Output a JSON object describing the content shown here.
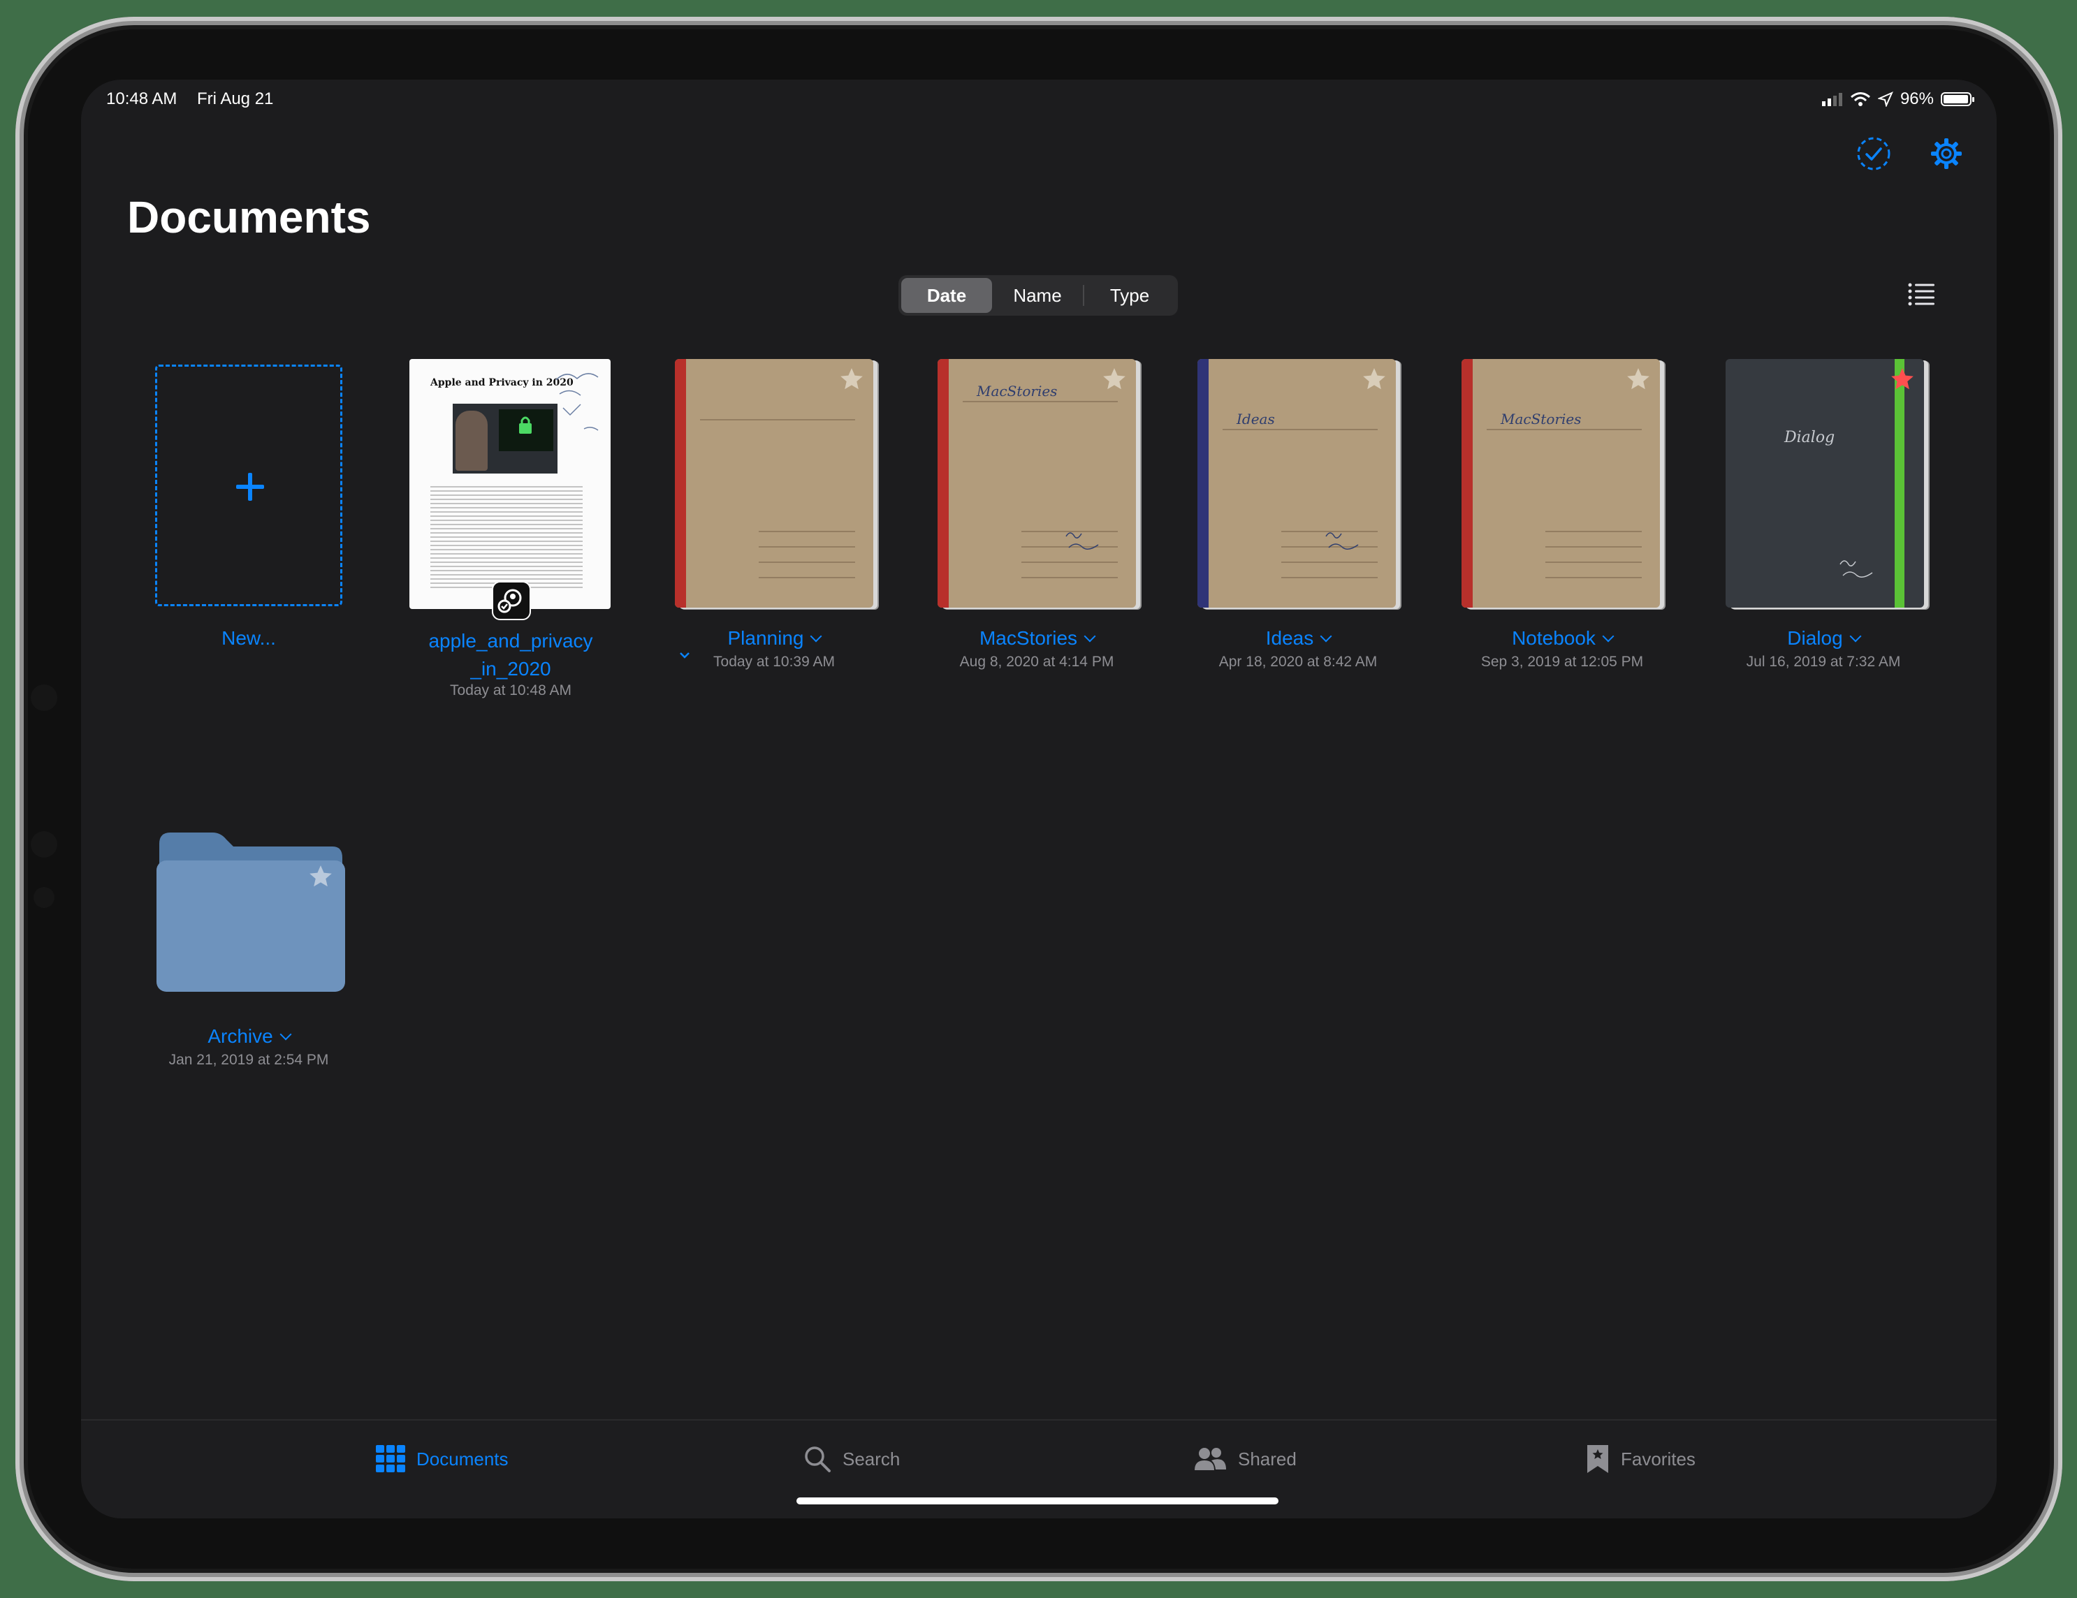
{
  "status_bar": {
    "time": "10:48 AM",
    "date": "Fri Aug 21",
    "battery": "96%",
    "battery_level": 0.96
  },
  "header": {
    "title": "Documents",
    "select_icon": "checkmark-circle-icon",
    "settings_icon": "gear-icon"
  },
  "sort": {
    "options": [
      "Date",
      "Name",
      "Type"
    ],
    "selected": "Date"
  },
  "view_toggle_icon": "list-icon",
  "new_item": {
    "label": "New..."
  },
  "documents": [
    {
      "name_line1": "apple_and_privacy",
      "name_line2": "_in_2020",
      "date": "Today at 10:48 AM"
    },
    {
      "name": "Planning",
      "date": "Today at 10:39 AM",
      "spine_color": "#b8302b"
    },
    {
      "name": "MacStories",
      "date": "Aug 8, 2020 at 4:14 PM",
      "spine_color": "#b8302b",
      "cover_text": "MacStories"
    },
    {
      "name": "Ideas",
      "date": "Apr 18, 2020 at 8:42 AM",
      "spine_color": "#2f3477",
      "cover_text": "Ideas"
    },
    {
      "name": "Notebook",
      "date": "Sep 3, 2019 at 12:05 PM",
      "spine_color": "#b8302b",
      "cover_text": "MacStories"
    },
    {
      "name": "Dialog",
      "date": "Jul 16, 2019 at 7:32 AM",
      "spine_color": "#5bc236",
      "cover_text": "Dialog",
      "favorite": true
    }
  ],
  "pdf_preview": {
    "heading": "Apple and Privacy in 2020"
  },
  "folders": [
    {
      "name": "Archive",
      "date": "Jan 21, 2019 at 2:54 PM",
      "color": "#6e93bd"
    }
  ],
  "tabbar": {
    "items": [
      {
        "label": "Documents",
        "icon": "grid-icon",
        "active": true
      },
      {
        "label": "Search",
        "icon": "magnifier-icon"
      },
      {
        "label": "Shared",
        "icon": "people-icon"
      },
      {
        "label": "Favorites",
        "icon": "bookmark-star-icon"
      }
    ]
  },
  "colors": {
    "accent": "#0a84ff",
    "background": "#1c1c1e",
    "favorite": "#ff4f4f"
  }
}
